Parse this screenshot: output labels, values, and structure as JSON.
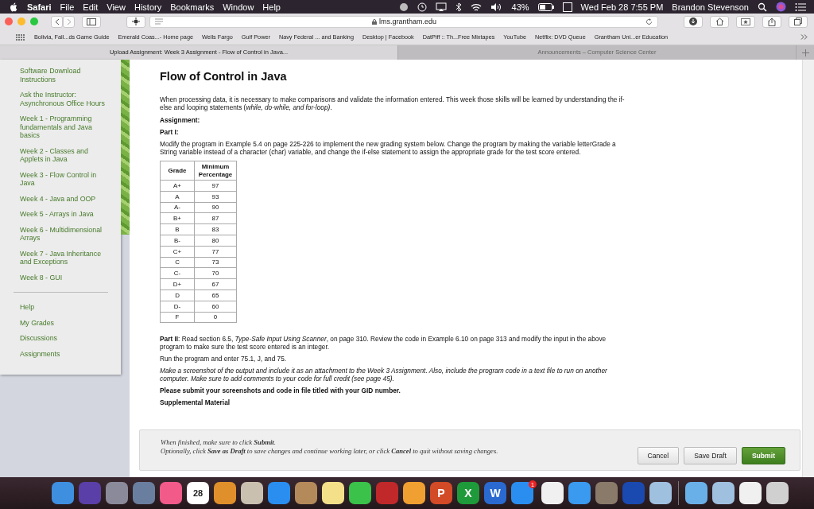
{
  "menu_bar": {
    "app": "Safari",
    "items": [
      "File",
      "Edit",
      "View",
      "History",
      "Bookmarks",
      "Window",
      "Help"
    ],
    "battery": "43%",
    "clock": "Wed Feb 28  7:55 PM",
    "user": "Brandon Stevenson"
  },
  "toolbar": {
    "url": "lms.grantham.edu"
  },
  "bookmarks": [
    "Bolivia, Fall...ds Game Guide",
    "Emerald Coas...- Home page",
    "Wells Fargo",
    "Gulf Power",
    "Navy Federal ... and Banking",
    "Desktop | Facebook",
    "DatPiff :: Th...Free Mixtapes",
    "YouTube",
    "Netflix: DVD Queue",
    "Grantham Uni...er Education"
  ],
  "tabs": [
    {
      "label": "Upload Assignment: Week 3 Assignment - Flow of Control in Java...",
      "selected": true
    },
    {
      "label": "Announcements – Computer Science Center",
      "selected": false
    }
  ],
  "sidebar": {
    "items": [
      "Software Download Instructions",
      "Ask the Instructor: Asynchronous Office Hours",
      "Week 1 - Programming fundamentals and Java basics",
      "Week 2 - Classes and Applets in Java",
      "Week 3 - Flow Control in Java",
      "Week 4 - Java and OOP",
      "Week 5 - Arrays in Java",
      "Week 6 - Multidimensional Arrays",
      "Week 7 - Java Inheritance and Exceptions",
      "Week 8 - GUI"
    ],
    "links": [
      "Help",
      "My Grades",
      "Discussions",
      "Assignments"
    ]
  },
  "page": {
    "title": "Flow of Control in Java",
    "intro": "When processing data, it is necessary to make comparisons and validate the information entered. This week those skills will be learned by understanding the if-else and looping statements (*while, do-while, and for-loop)*.",
    "assignment_heading": "Assignment:",
    "part1_heading": "Part I:",
    "part1_text": "Modify the program in Example 5.4 on page 225-226 to implement the new grading system below. Change the program by making the variable letterGrade a String variable instead of a character (char) variable, and change the if-else statement to assign the appropriate grade for the test score entered.",
    "table": {
      "columns": [
        "Grade",
        "Minimum Percentage"
      ],
      "rows": [
        [
          "A+",
          "97"
        ],
        [
          "A",
          "93"
        ],
        [
          "A-",
          "90"
        ],
        [
          "B+",
          "87"
        ],
        [
          "B",
          "83"
        ],
        [
          "B-",
          "80"
        ],
        [
          "C+",
          "77"
        ],
        [
          "C",
          "73"
        ],
        [
          "C-",
          "70"
        ],
        [
          "D+",
          "67"
        ],
        [
          "D",
          "65"
        ],
        [
          "D-",
          "60"
        ],
        [
          "F",
          "0"
        ]
      ]
    },
    "part2_text": "**Part II**: Read section 6.5, *Type-Safe Input Using Scanner*, on page 310. Review the code in Example 6.10 on page 313 and modify the input in the above program to make sure the test score entered is an integer.",
    "run_text": "Run the program and enter 75.1, J, and 75.",
    "screenshot_text": "Make a screenshot of the output and include it as an attachment to the Week 3 Assignment. Also, include the program code in a text file to run on another computer. Make sure to add comments to your code for full credit (see page 45).",
    "submit_note": "Please submit your screenshots and code in file titled with your GID number.",
    "supplemental_heading": "Supplemental Material"
  },
  "footer": {
    "lines": [
      "When finished, make sure to click **Submit**.",
      "Optionally, click **Save as Draft** to save changes and continue working later, or click **Cancel** to quit without saving changes."
    ],
    "buttons": [
      {
        "label": "Cancel",
        "kind": "plain"
      },
      {
        "label": "Save Draft",
        "kind": "plain"
      },
      {
        "label": "Submit",
        "kind": "primary"
      }
    ]
  },
  "dock": {
    "apps": [
      {
        "color": "#3f8fe0"
      },
      {
        "color": "#5b3fa8"
      },
      {
        "color": "#8a8a9a"
      },
      {
        "color": "#6a7fa0"
      },
      {
        "color": "#f25a8a"
      },
      {
        "color": "#ffffff",
        "label": "28"
      },
      {
        "color": "#e0902a"
      },
      {
        "color": "#c9c0b0"
      },
      {
        "color": "#2a8ef0"
      },
      {
        "color": "#b58a5a"
      },
      {
        "color": "#f5e08a"
      },
      {
        "color": "#3ac24a"
      },
      {
        "color": "#c0282a"
      },
      {
        "color": "#f0a030"
      },
      {
        "color": "#d24a26",
        "label": "P"
      },
      {
        "color": "#1f9a3a",
        "label": "X"
      },
      {
        "color": "#2a6ad0",
        "label": "W"
      },
      {
        "color": "#2a8ef0",
        "badge": "1"
      },
      {
        "color": "#f0f0f0"
      },
      {
        "color": "#3a9af0"
      },
      {
        "color": "#8a7a6a"
      },
      {
        "color": "#1a4ab0"
      },
      {
        "color": "#a0c0e0"
      }
    ],
    "stacks": [
      {
        "color": "#6ab0e8"
      },
      {
        "color": "#a0c0e0"
      },
      {
        "color": "#f0f0f0"
      },
      {
        "color": "#d0d0d0"
      }
    ]
  }
}
